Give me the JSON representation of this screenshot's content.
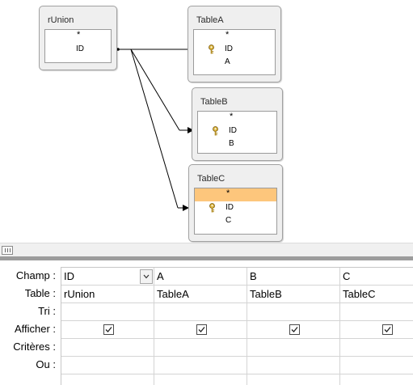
{
  "tables": [
    {
      "name": "rUnion",
      "fields": [
        {
          "text": "*",
          "key": false
        },
        {
          "text": "ID",
          "key": false
        }
      ]
    },
    {
      "name": "TableA",
      "fields": [
        {
          "text": "*",
          "key": false
        },
        {
          "text": "ID",
          "key": true
        },
        {
          "text": "A",
          "key": false
        }
      ]
    },
    {
      "name": "TableB",
      "fields": [
        {
          "text": "*",
          "key": false
        },
        {
          "text": "ID",
          "key": true
        },
        {
          "text": "B",
          "key": false
        }
      ]
    },
    {
      "name": "TableC",
      "fields": [
        {
          "text": "*",
          "key": false,
          "highlighted": true
        },
        {
          "text": "ID",
          "key": true
        },
        {
          "text": "C",
          "key": false
        }
      ]
    }
  ],
  "grid": {
    "row_labels": [
      "Champ :",
      "Table :",
      "Tri :",
      "Afficher :",
      "Critères :",
      "Ou :"
    ],
    "columns": [
      {
        "champ": "ID",
        "table": "rUnion",
        "tri": "",
        "afficher": true,
        "criteres": "",
        "ou": ""
      },
      {
        "champ": "A",
        "table": "TableA",
        "tri": "",
        "afficher": true,
        "criteres": "",
        "ou": ""
      },
      {
        "champ": "B",
        "table": "TableB",
        "tri": "",
        "afficher": true,
        "criteres": "",
        "ou": ""
      },
      {
        "champ": "C",
        "table": "TableC",
        "tri": "",
        "afficher": true,
        "criteres": "",
        "ou": ""
      }
    ]
  },
  "colors": {
    "highlight": "#fdc67c",
    "box_bg": "#efefef",
    "border": "#a0a0a0"
  }
}
